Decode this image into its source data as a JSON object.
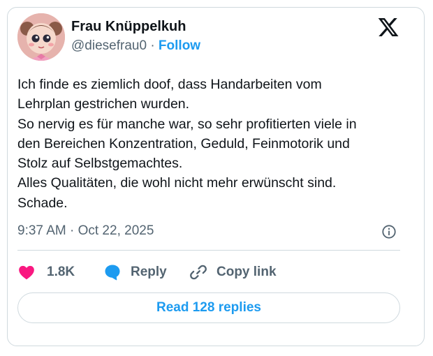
{
  "colors": {
    "accent": "#1d9bf0",
    "like": "#f91880",
    "text": "#0f1419",
    "muted": "#536471",
    "border": "#cfd9de"
  },
  "author": {
    "display_name": "Frau Knüppelkuh",
    "handle": "@diesefrau0",
    "separator": "·",
    "follow_label": "Follow",
    "avatar_icon": "doll-avatar"
  },
  "platform_icon": "x-logo-icon",
  "tweet": {
    "lines": [
      "Ich finde es ziemlich doof, dass Handarbeiten vom",
      "Lehrplan gestrichen wurden.",
      "So nervig es für manche war, so sehr profitierten viele in",
      "den Bereichen Konzentration, Geduld, Feinmotorik und",
      "Stolz auf Selbstgemachtes.",
      "Alles Qualitäten, die wohl nicht mehr erwünscht sind.",
      "Schade."
    ],
    "timestamp": "9:37 AM · Oct 22, 2025"
  },
  "actions": {
    "like_count": "1.8K",
    "reply_label": "Reply",
    "copy_label": "Copy link"
  },
  "read_replies_label": "Read 128 replies"
}
